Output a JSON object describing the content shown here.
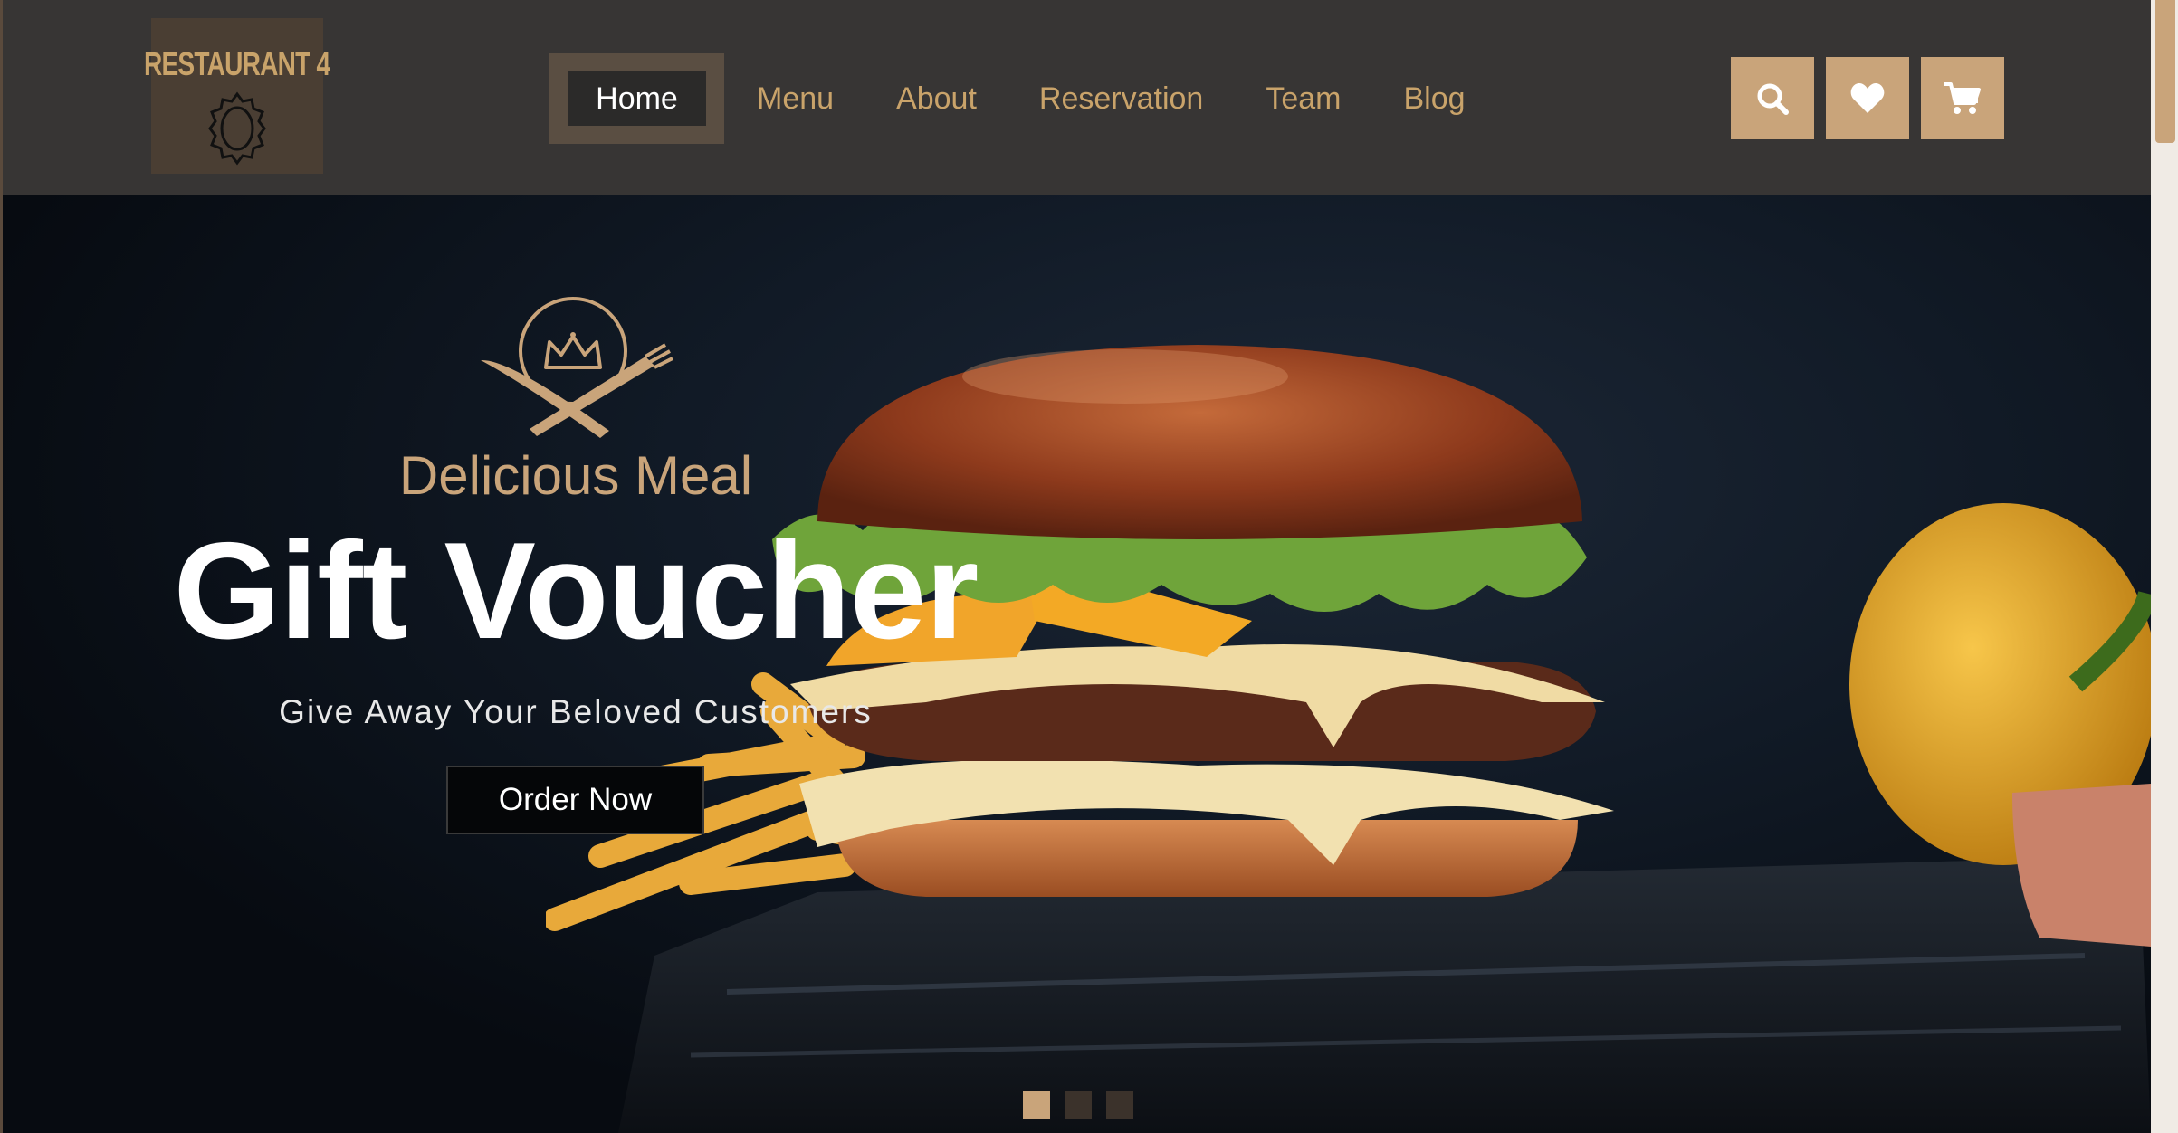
{
  "logo": {
    "text": "RESTAURANT 4"
  },
  "nav": {
    "items": [
      {
        "label": "Home",
        "active": true
      },
      {
        "label": "Menu"
      },
      {
        "label": "About"
      },
      {
        "label": "Reservation"
      },
      {
        "label": "Team"
      },
      {
        "label": "Blog"
      }
    ]
  },
  "header_icons": [
    "search-icon",
    "heart-icon",
    "cart-icon"
  ],
  "hero": {
    "subtitle": "Delicious Meal",
    "title": "Gift Voucher",
    "tagline": "Give Away Your Beloved Customers",
    "cta": "Order Now"
  },
  "slider": {
    "count": 3,
    "active_index": 0
  },
  "colors": {
    "accent": "#c9a47a",
    "header_bg": "#373534",
    "hero_bg": "#0b0e14",
    "text_light": "#ffffff"
  }
}
